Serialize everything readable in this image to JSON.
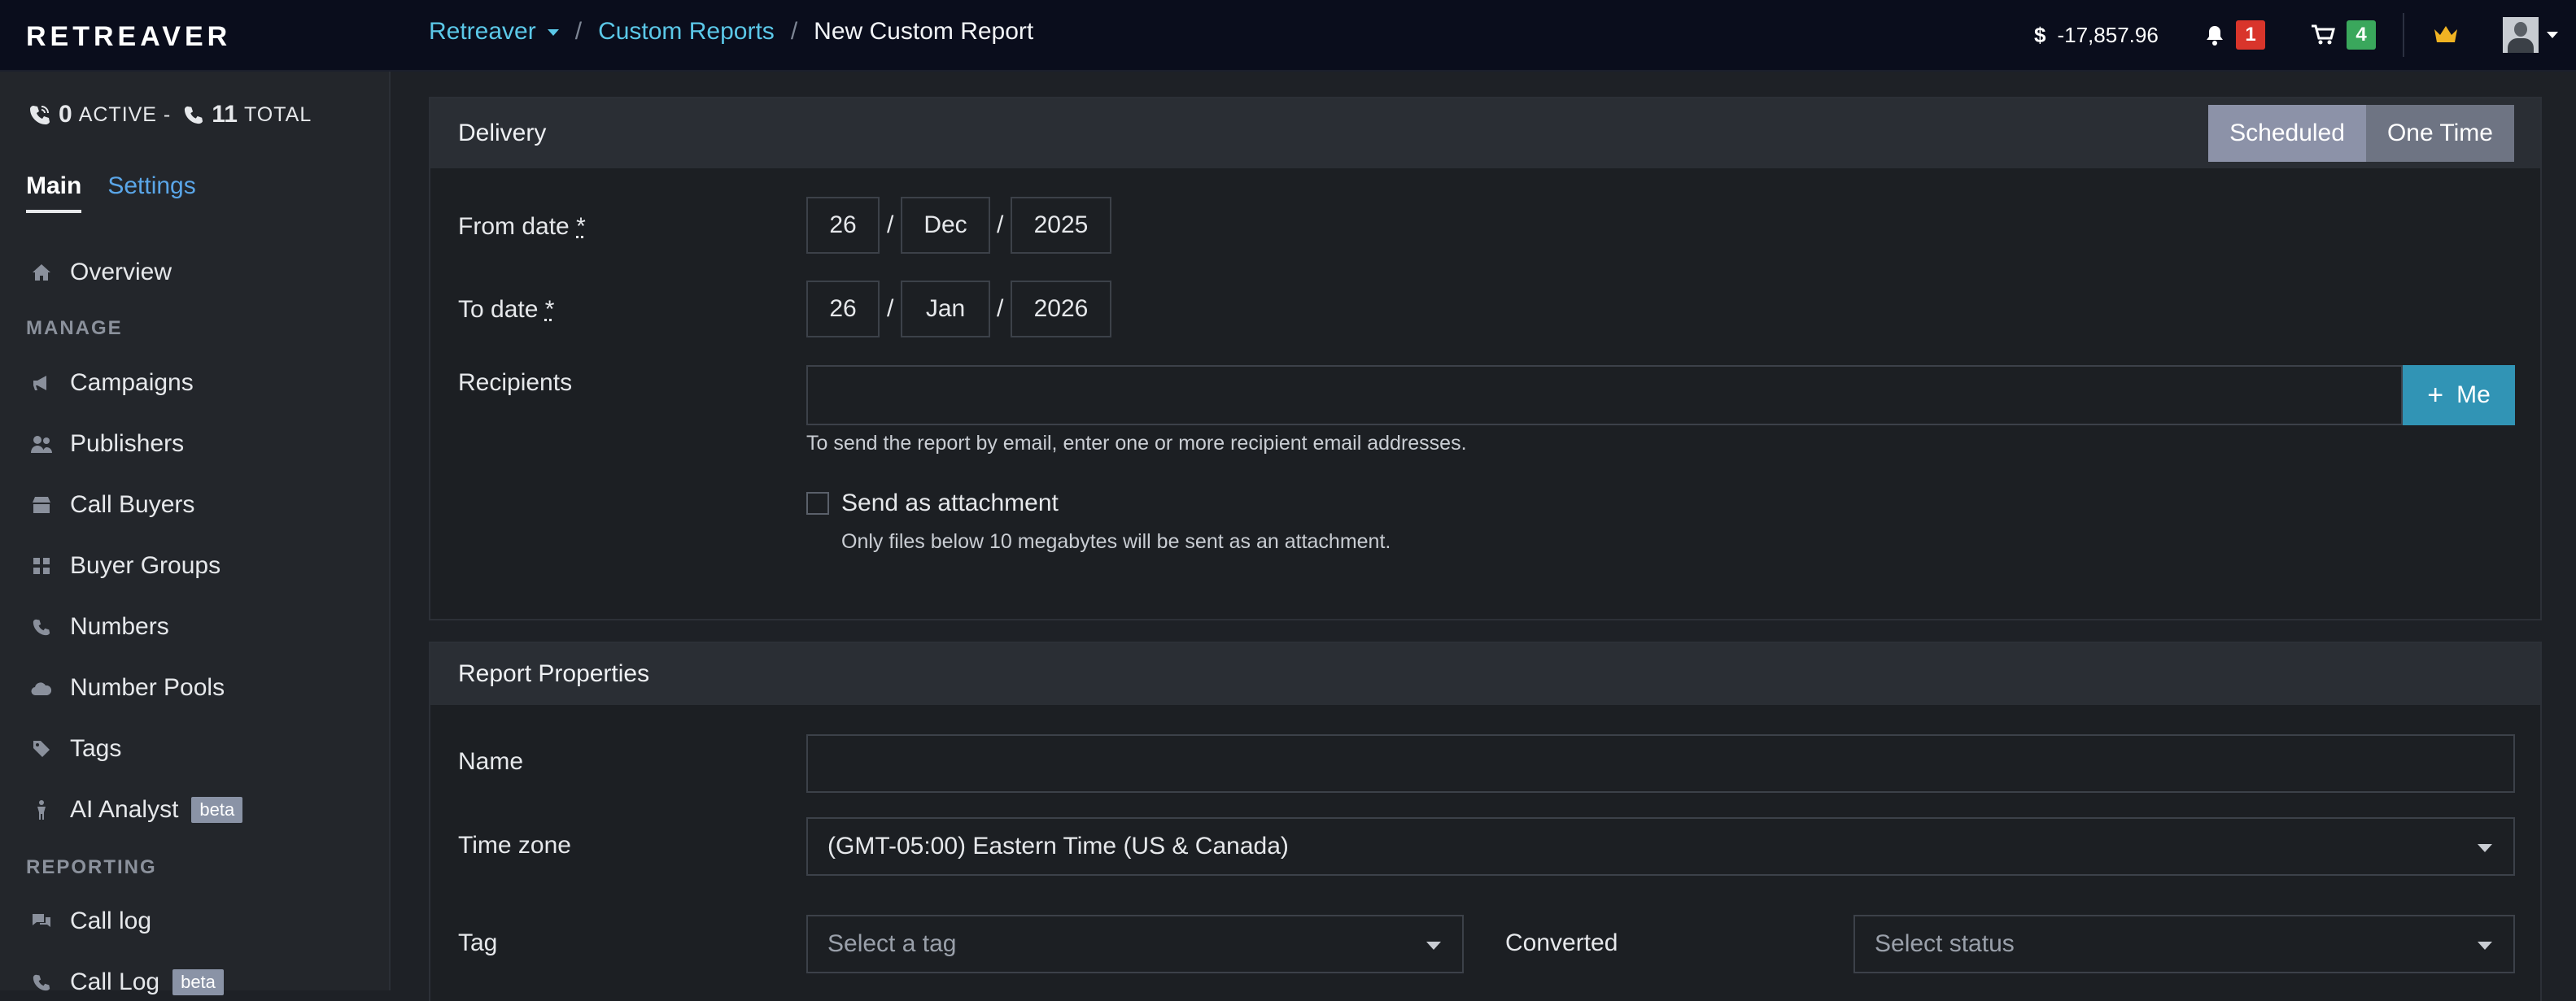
{
  "app": {
    "logo": "RETREAVER"
  },
  "breadcrumb": {
    "root": "Retreaver",
    "parent": "Custom Reports",
    "current": "New Custom Report",
    "separator": "/"
  },
  "topbar": {
    "balance": "-17,857.96",
    "currency_symbol": "$",
    "notifications_count": "1",
    "cart_count": "4",
    "colors": {
      "notification_badge": "#d9352b",
      "cart_badge": "#3aa75c",
      "crown": "#f0b323"
    }
  },
  "sidebar": {
    "stats": {
      "active_count": "0",
      "active_label": "ACTIVE -",
      "total_count": "11",
      "total_label": "TOTAL"
    },
    "tabs": [
      {
        "label": "Main"
      },
      {
        "label": "Settings"
      }
    ],
    "overview": {
      "label": "Overview",
      "icon": "home-icon"
    },
    "manage_heading": "MANAGE",
    "manage_items": [
      {
        "label": "Campaigns",
        "icon": "megaphone-icon"
      },
      {
        "label": "Publishers",
        "icon": "users-icon"
      },
      {
        "label": "Call Buyers",
        "icon": "store-icon"
      },
      {
        "label": "Buyer Groups",
        "icon": "grid-icon"
      },
      {
        "label": "Numbers",
        "icon": "phone-icon"
      },
      {
        "label": "Number Pools",
        "icon": "cloud-icon"
      },
      {
        "label": "Tags",
        "icon": "tag-icon"
      },
      {
        "label": "AI Analyst",
        "icon": "person-icon",
        "badge": "beta"
      }
    ],
    "reporting_heading": "REPORTING",
    "reporting_items": [
      {
        "label": "Call log",
        "icon": "chat-icon"
      },
      {
        "label": "Call Log",
        "icon": "phone-call-icon",
        "badge": "beta"
      }
    ]
  },
  "delivery": {
    "title": "Delivery",
    "mode_scheduled": "Scheduled",
    "mode_one_time": "One Time",
    "from_label": "From date",
    "to_label": "To date",
    "required_mark": "*",
    "from": {
      "day": "26",
      "month": "Dec",
      "year": "2025"
    },
    "to": {
      "day": "26",
      "month": "Jan",
      "year": "2026"
    },
    "recipients_label": "Recipients",
    "recipients_value": "",
    "me_button": "Me",
    "recipients_help": "To send the report by email, enter one or more recipient email addresses.",
    "attachment_label": "Send as attachment",
    "attachment_help": "Only files below 10 megabytes will be sent as an attachment."
  },
  "properties": {
    "title": "Report Properties",
    "name_label": "Name",
    "name_value": "",
    "timezone_label": "Time zone",
    "timezone_value": "(GMT-05:00) Eastern Time (US & Canada)",
    "tag_label": "Tag",
    "tag_placeholder": "Select a tag",
    "converted_label": "Converted",
    "converted_placeholder": "Select status"
  }
}
